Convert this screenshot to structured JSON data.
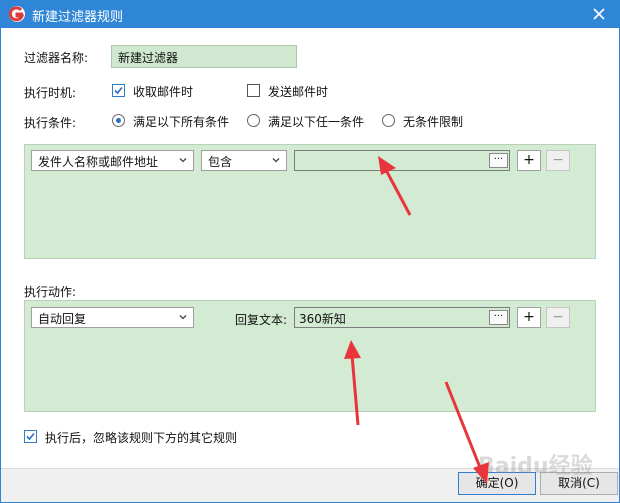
{
  "window": {
    "title": "新建过滤器规则"
  },
  "form": {
    "name_label": "过滤器名称:",
    "name_value": "新建过滤器",
    "timing_label": "执行时机:",
    "timing_receive": "收取邮件时",
    "timing_send": "发送邮件时",
    "condition_label": "执行条件:",
    "cond_all": "满足以下所有条件",
    "cond_any": "满足以下任一条件",
    "cond_none": "无条件限制"
  },
  "condition_row": {
    "field_select": "发件人名称或邮件地址",
    "op_select": "包含",
    "value": "",
    "dots": "···",
    "add": "+",
    "remove": "−"
  },
  "action": {
    "label": "执行动作:",
    "select": "自动回复",
    "reply_label": "回复文本:",
    "reply_value": "360新知",
    "dots": "···",
    "add": "+",
    "remove": "−"
  },
  "ignore_rules": "执行后，忽略该规则下方的其它规则",
  "buttons": {
    "ok": "确定(O)",
    "cancel": "取消(C)"
  },
  "watermark": "Baidu经验",
  "colors": {
    "titlebar": "#2f86d6",
    "panel": "#d3ead3",
    "arrow": "#e8353b"
  }
}
